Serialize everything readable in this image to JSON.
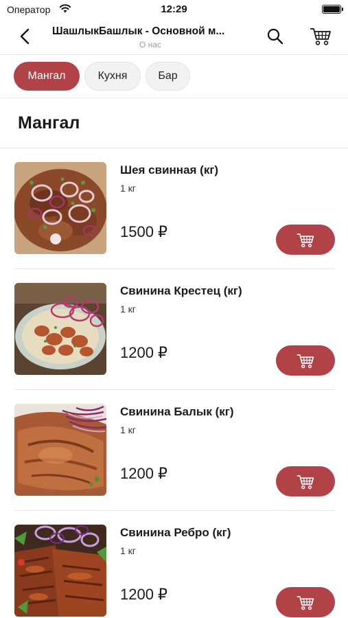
{
  "status_bar": {
    "carrier": "Оператор",
    "time": "12:29"
  },
  "nav": {
    "title": "ШашлыкБашлык - Основной м...",
    "subtitle": "О нас",
    "icons": [
      "chevron-left-icon",
      "search-icon",
      "cart-icon"
    ]
  },
  "tabs": [
    {
      "label": "Мангал",
      "active": true
    },
    {
      "label": "Кухня",
      "active": false
    },
    {
      "label": "Бар",
      "active": false
    }
  ],
  "section": {
    "title": "Мангал"
  },
  "items": [
    {
      "name": "Шея свинная (кг)",
      "weight": "1 кг",
      "price": "1500 ₽"
    },
    {
      "name": "Свинина Крестец (кг)",
      "weight": "1 кг",
      "price": "1200 ₽"
    },
    {
      "name": "Свинина Балык (кг)",
      "weight": "1 кг",
      "price": "1200 ₽"
    },
    {
      "name": "Свинина Ребро (кг)",
      "weight": "1 кг",
      "price": "1200 ₽"
    }
  ],
  "colors": {
    "accent": "#b04248",
    "tab_inactive_bg": "#f2f2f2",
    "divider": "#e6e6e6"
  }
}
